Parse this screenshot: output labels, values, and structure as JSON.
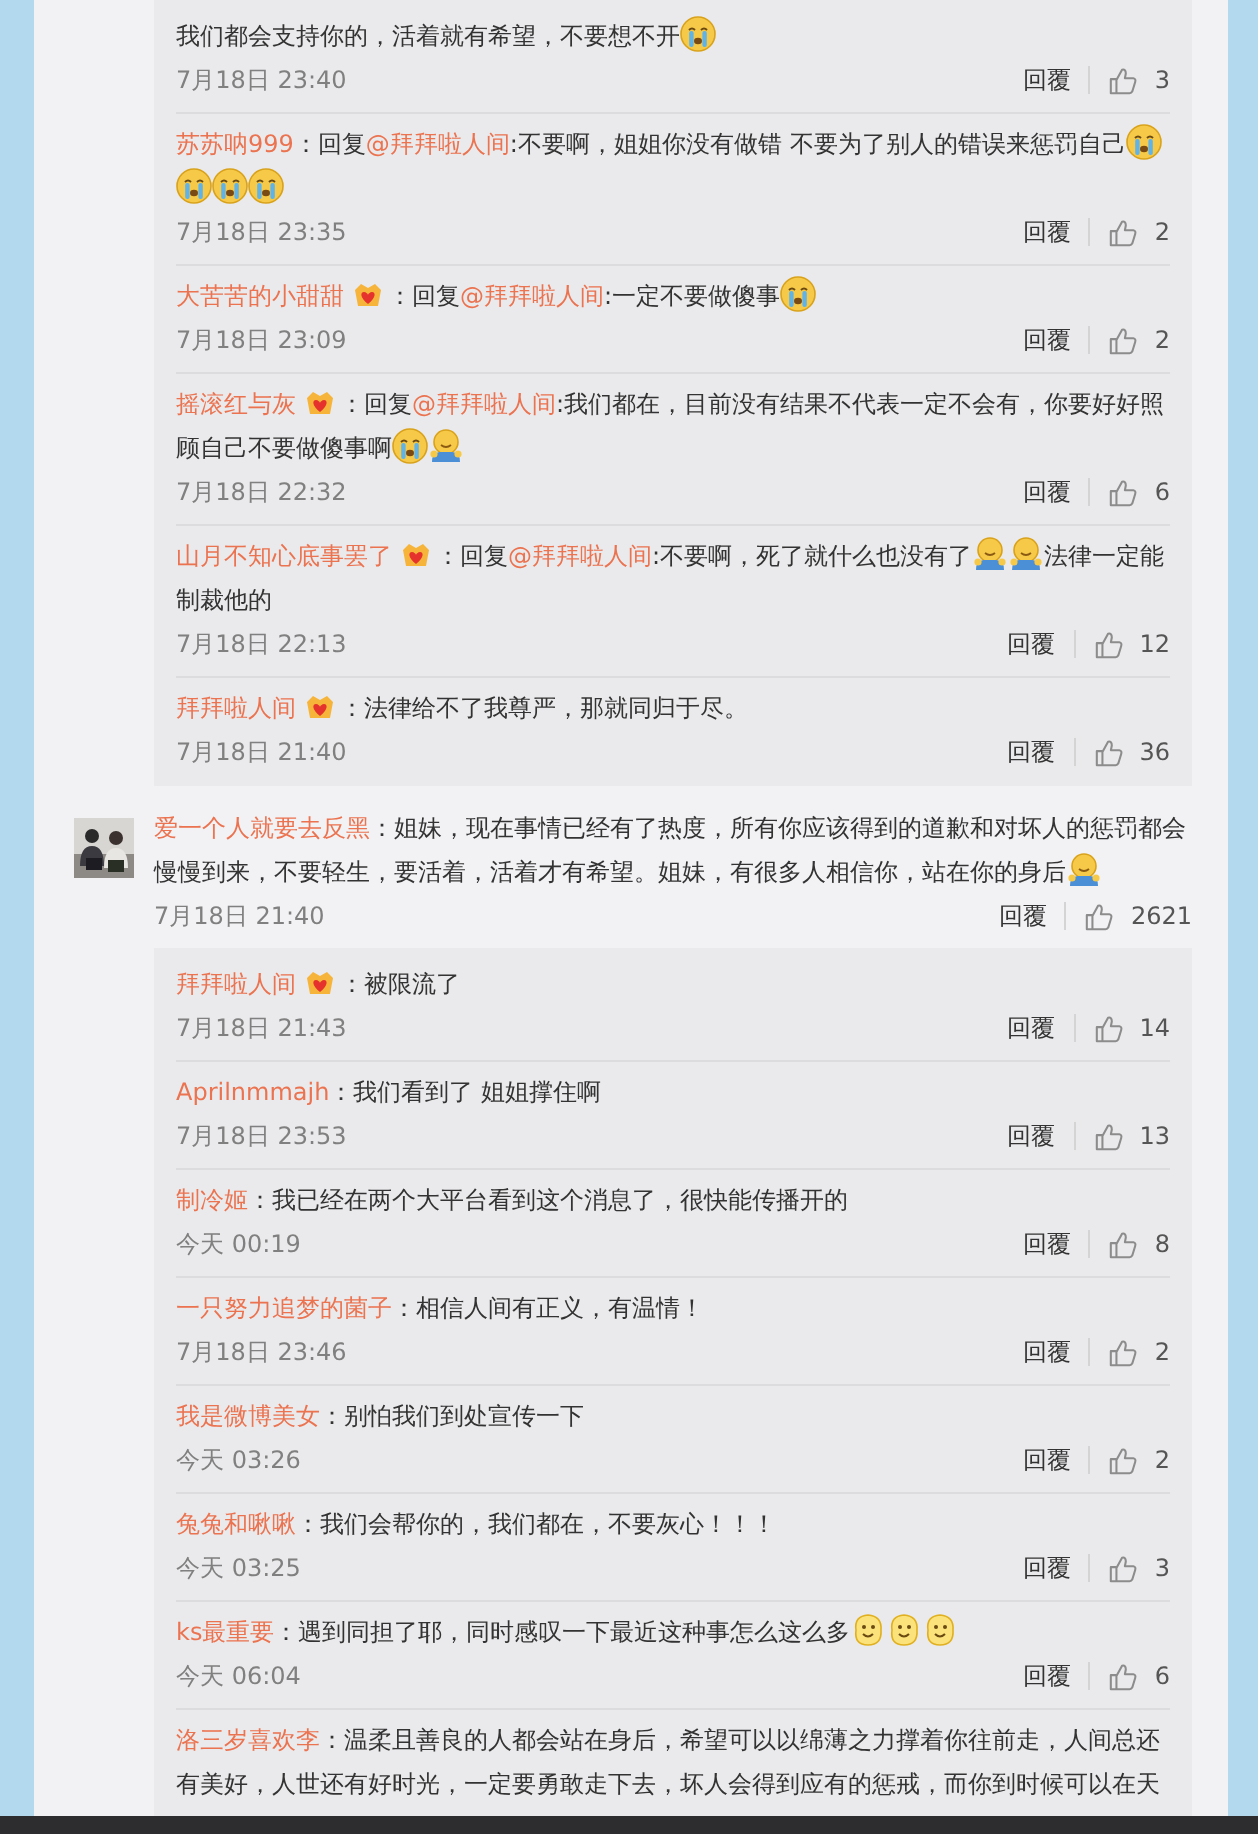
{
  "top_replies": [
    {
      "badge": false,
      "parts": [
        {
          "kind": "text",
          "text": "我们都会支持你的，活着就有希望，不要想不开"
        },
        {
          "kind": "cry"
        }
      ],
      "time": "7月18日 23:40",
      "reply_label": "回覆",
      "likes": "3"
    },
    {
      "user": "苏苏呐999",
      "badge": false,
      "parts": [
        {
          "kind": "text",
          "text": "：回复"
        },
        {
          "kind": "mention",
          "text": "@拜拜啦人间"
        },
        {
          "kind": "text",
          "text": ":不要啊，姐姐你没有做错 不要为了别人的错误来惩罚自己"
        },
        {
          "kind": "cry"
        },
        {
          "kind": "cry"
        },
        {
          "kind": "cry"
        },
        {
          "kind": "cry"
        }
      ],
      "time": "7月18日 23:35",
      "reply_label": "回覆",
      "likes": "2"
    },
    {
      "user": "大苦苦的小甜甜",
      "badge": true,
      "parts": [
        {
          "kind": "text",
          "text": "：回复"
        },
        {
          "kind": "mention",
          "text": "@拜拜啦人间"
        },
        {
          "kind": "text",
          "text": ":一定不要做傻事"
        },
        {
          "kind": "cry"
        }
      ],
      "time": "7月18日 23:09",
      "reply_label": "回覆",
      "likes": "2"
    },
    {
      "user": "摇滚红与灰",
      "badge": true,
      "parts": [
        {
          "kind": "text",
          "text": "：回复"
        },
        {
          "kind": "mention",
          "text": "@拜拜啦人间"
        },
        {
          "kind": "text",
          "text": ":我们都在，目前没有结果不代表一定不会有，你要好好照顾自己不要做傻事啊"
        },
        {
          "kind": "cry"
        },
        {
          "kind": "hug"
        }
      ],
      "time": "7月18日 22:32",
      "reply_label": "回覆",
      "likes": "6"
    },
    {
      "user": "山月不知心底事罢了",
      "badge": true,
      "parts": [
        {
          "kind": "text",
          "text": "：回复"
        },
        {
          "kind": "mention",
          "text": "@拜拜啦人间"
        },
        {
          "kind": "text",
          "text": ":不要啊，死了就什么也没有了"
        },
        {
          "kind": "hug"
        },
        {
          "kind": "hug"
        },
        {
          "kind": "text",
          "text": "法律一定能制裁他的"
        }
      ],
      "time": "7月18日 22:13",
      "reply_label": "回覆",
      "likes": "12"
    },
    {
      "user": "拜拜啦人间",
      "badge": true,
      "parts": [
        {
          "kind": "text",
          "text": "：法律给不了我尊严，那就同归于尽。"
        }
      ],
      "time": "7月18日 21:40",
      "reply_label": "回覆",
      "likes": "36"
    }
  ],
  "comment": {
    "user": "爱一个人就要去反黑",
    "badge": false,
    "parts": [
      {
        "kind": "text",
        "text": "：姐妹，现在事情已经有了热度，所有你应该得到的道歉和对坏人的惩罚都会慢慢到来，不要轻生，要活着，活着才有希望。姐妹，有很多人相信你，站在你的身后"
      },
      {
        "kind": "hug"
      }
    ],
    "time": "7月18日 21:40",
    "reply_label": "回覆",
    "likes": "2621",
    "replies": [
      {
        "user": "拜拜啦人间",
        "badge": true,
        "parts": [
          {
            "kind": "text",
            "text": "：被限流了"
          }
        ],
        "time": "7月18日 21:43",
        "reply_label": "回覆",
        "likes": "14"
      },
      {
        "user": "Aprilnmmajh",
        "badge": false,
        "parts": [
          {
            "kind": "text",
            "text": "：我们看到了 姐姐撑住啊"
          }
        ],
        "time": "7月18日 23:53",
        "reply_label": "回覆",
        "likes": "13"
      },
      {
        "user": "制冷姬",
        "badge": false,
        "parts": [
          {
            "kind": "text",
            "text": "：我已经在两个大平台看到这个消息了，很快能传播开的"
          }
        ],
        "time": "今天 00:19",
        "reply_label": "回覆",
        "likes": "8"
      },
      {
        "user": "一只努力追梦的菌子",
        "badge": false,
        "parts": [
          {
            "kind": "text",
            "text": "：相信人间有正义，有温情！"
          }
        ],
        "time": "7月18日 23:46",
        "reply_label": "回覆",
        "likes": "2"
      },
      {
        "user": "我是微博美女",
        "badge": false,
        "parts": [
          {
            "kind": "text",
            "text": "：别怕我们到处宣传一下"
          }
        ],
        "time": "今天 03:26",
        "reply_label": "回覆",
        "likes": "2"
      },
      {
        "user": "兔兔和啾啾",
        "badge": false,
        "parts": [
          {
            "kind": "text",
            "text": "：我们会帮你的，我们都在，不要灰心！！！"
          }
        ],
        "time": "今天 03:25",
        "reply_label": "回覆",
        "likes": "3"
      },
      {
        "user": "ks最重要",
        "badge": false,
        "parts": [
          {
            "kind": "text",
            "text": "：遇到同担了耶，同时感叹一下最近这种事怎么这么多"
          },
          {
            "kind": "smile"
          },
          {
            "kind": "smile"
          },
          {
            "kind": "smile"
          }
        ],
        "time": "今天 06:04",
        "reply_label": "回覆",
        "likes": "6"
      },
      {
        "user": "洛三岁喜欢李",
        "badge": false,
        "parts": [
          {
            "kind": "text",
            "text": "：温柔且善良的人都会站在身后，希望可以以绵薄之力撑着你往前走，人间总还有美好，人世还有好时光，一定要勇敢走下去，坏人会得到应有的惩戒，而你到时候可以在天"
          }
        ]
      }
    ]
  }
}
